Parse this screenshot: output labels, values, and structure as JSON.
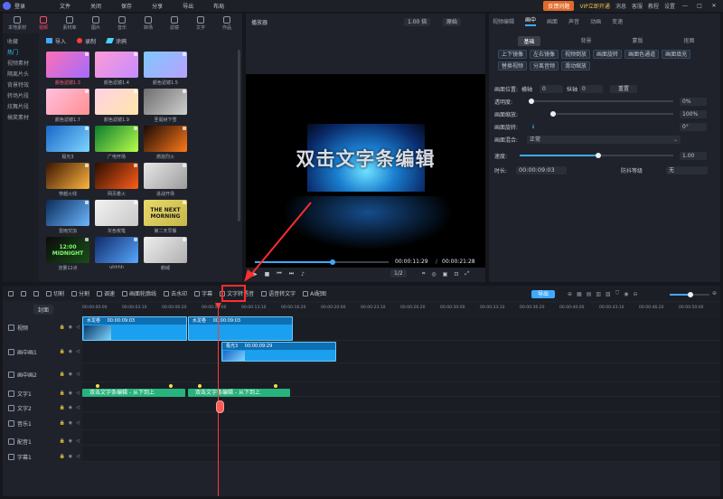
{
  "titlebar": {
    "title": "登录",
    "menus": [
      "文件",
      "关闭",
      "保存",
      "分享",
      "导出",
      "布局"
    ],
    "feedback": "反馈问题",
    "vip": "VIP立即开通",
    "right": [
      "消息",
      "客服",
      "教程",
      "设置"
    ]
  },
  "library": {
    "tabs": [
      "本地素材",
      "视频",
      "素材库",
      "图片",
      "音乐",
      "转场",
      "滤镜",
      "文字",
      "作品"
    ],
    "categories": [
      "收藏",
      "热门",
      "视频素材",
      "隔离片头",
      "背景特效",
      "转场片段",
      "炫舞片段",
      "搞笑素材"
    ],
    "sub": {
      "import": "导入",
      "record": "录制",
      "clip": "涂鸦"
    },
    "tiles": [
      {
        "label": "颜色滤镜1.3",
        "pink": true,
        "colors": [
          "#ff6fb5",
          "#a06cff"
        ]
      },
      {
        "label": "颜色滤镜1.4",
        "pink": false,
        "colors": [
          "#ff9ad5",
          "#c58cff"
        ]
      },
      {
        "label": "颜色滤镜1.5",
        "pink": false,
        "colors": [
          "#7ec8ff",
          "#b9a1ff"
        ]
      },
      {
        "label": "颜色滤镜1.7",
        "pink": false,
        "colors": [
          "#ffc0e0",
          "#ff9090"
        ]
      },
      {
        "label": "颜色滤镜1.9",
        "pink": false,
        "colors": [
          "#ffd1e6",
          "#ffe6a8"
        ]
      },
      {
        "label": "圣诞树下雪",
        "pink": false,
        "colors": [
          "#6e6e6e",
          "#cfcfcf"
        ]
      },
      {
        "label": "极光3",
        "pink": false,
        "colors": [
          "#1966c8",
          "#7fd6ff"
        ]
      },
      {
        "label": "广电开场",
        "pink": false,
        "colors": [
          "#0a7c2e",
          "#b8ff4a"
        ]
      },
      {
        "label": "燃烧烈火",
        "pink": false,
        "colors": [
          "#1a0a05",
          "#ff7a1a"
        ]
      },
      {
        "label": "穿越火线",
        "pink": false,
        "colors": [
          "#3a1500",
          "#ffb640"
        ]
      },
      {
        "label": "网页着火",
        "pink": false,
        "colors": [
          "#2b0d00",
          "#ff5e1a"
        ]
      },
      {
        "label": "进战开场",
        "pink": false,
        "colors": [
          "#e8e8e8",
          "#9b9b9b"
        ]
      },
      {
        "label": "雷雨交加",
        "pink": false,
        "colors": [
          "#0a2b5a",
          "#6db7ff"
        ]
      },
      {
        "label": "灰色炭笔",
        "pink": false,
        "colors": [
          "#f2f2f2",
          "#c8c8c8"
        ]
      },
      {
        "label": "第二天早餐",
        "pink": false,
        "colors": [
          "#e8d86a",
          "#c8b84a"
        ],
        "text": "THE NEXT MORNING"
      },
      {
        "label": "流量12点",
        "pink": false,
        "colors": [
          "#0b0b0b",
          "#1a4d1a"
        ],
        "text": "12:00 MIDNIGHT"
      },
      {
        "label": "uhhhh",
        "pink": false,
        "colors": [
          "#0f2a6a",
          "#58a8ff"
        ]
      },
      {
        "label": "鹅绒",
        "pink": false,
        "colors": [
          "#eeeeee",
          "#b0b0b0"
        ]
      }
    ]
  },
  "preview": {
    "title": "播放器",
    "speed": "1.00 倍",
    "ratio": "原始",
    "overlay_text": "双击文字条编辑",
    "current_time": "00:00:11:29",
    "total_time": "00:00:21:28",
    "scale": "1/2",
    "progress": 0.58
  },
  "props": {
    "tabs": [
      "视频编辑",
      "画中",
      "画面",
      "声音",
      "动画",
      "变速"
    ],
    "active_tab_index": 1,
    "sub_tabs": [
      "基础",
      "背景",
      "蒙版",
      "抠图"
    ],
    "buttons": [
      "上下镜像",
      "左右镜像",
      "视频倒放",
      "画面旋转",
      "画面色通道",
      "画面填充",
      "替换视频",
      "分离音频",
      "滑动缩放"
    ],
    "position_label": "画面位置:",
    "pos_x_label": "横轴",
    "pos_x": "0",
    "pos_y_label": "纵轴",
    "pos_y": "0",
    "reset": "重置",
    "opacity_label": "透明度:",
    "opacity": "0%",
    "scale_label": "画面缩放:",
    "scale": "100%",
    "rotate_label": "画面旋转:",
    "rotate": "0°",
    "blend_label": "画面混合:",
    "blend": "正常",
    "speed_label": "速度:",
    "speed": "1.00",
    "duration_label": "时长:",
    "duration": "00:00:09:03",
    "shake_label": "防抖等级",
    "shake": "无"
  },
  "timeline": {
    "tools": [
      "撤销",
      "重做",
      "删除",
      "切割",
      "分割",
      "调速",
      "画面轮廓线",
      "去水印",
      "字幕",
      "文字转语音",
      "语音转文字",
      "AI配图"
    ],
    "highlighted_tool": "字幕",
    "export": "导出",
    "ruler": [
      "00:00:00:00",
      "00:00:03:10",
      "00:00:06:20",
      "00:00:10:00",
      "00:00:13:10",
      "00:00:16:20",
      "00:00:20:00",
      "00:00:23:10",
      "00:00:26:20",
      "00:00:30:00",
      "00:00:33:10",
      "00:00:36:20",
      "00:00:40:00",
      "00:00:43:10",
      "00:00:46:20",
      "00:00:50:00"
    ],
    "cover": "封面",
    "tracks": [
      {
        "name": "视频",
        "icon": "video-track-icon"
      },
      {
        "name": "画中画1",
        "icon": "pip-track-icon"
      },
      {
        "name": "画中画2",
        "icon": "pip-track-icon"
      },
      {
        "name": "文字1",
        "icon": "text-track-icon"
      },
      {
        "name": "文字2",
        "icon": "text-track-icon"
      },
      {
        "name": "音乐1",
        "icon": "music-track-icon"
      },
      {
        "name": "配音1",
        "icon": "voice-track-icon"
      },
      {
        "name": "字幕1",
        "icon": "subtitle-track-icon"
      }
    ],
    "clips": {
      "video1": {
        "name": "水龙卷",
        "time": "00:00:09:03"
      },
      "video2": {
        "name": "水龙卷",
        "time": "00:00:09:03"
      },
      "pip": {
        "name": "极光3",
        "time": "00:00:09:29"
      },
      "text1": {
        "label": "双击文字条编辑 - 从下到上"
      },
      "text2": {
        "label": "双击文字条编辑 - 从下到上"
      }
    }
  }
}
